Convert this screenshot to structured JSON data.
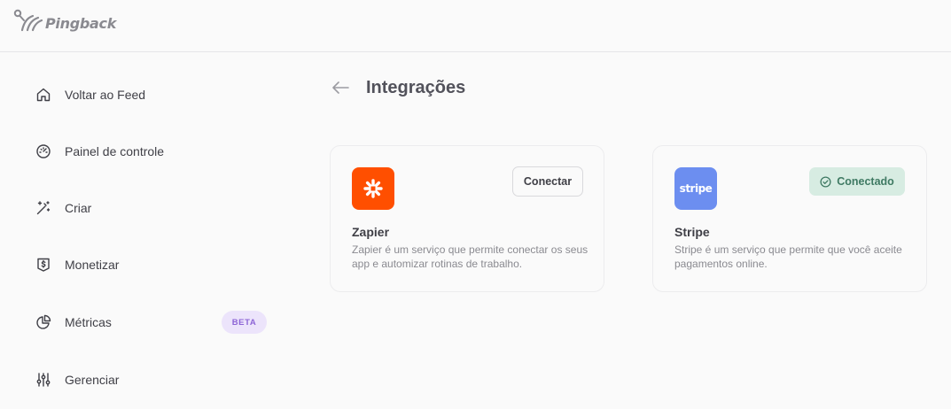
{
  "app": {
    "logo_text": "Pingback"
  },
  "sidebar": {
    "items": [
      {
        "label": "Voltar ao Feed",
        "icon": "home-icon"
      },
      {
        "label": "Painel de controle",
        "icon": "gauge-icon"
      },
      {
        "label": "Criar",
        "icon": "magic-wand-icon"
      },
      {
        "label": "Monetizar",
        "icon": "dollar-badge-icon"
      },
      {
        "label": "Métricas",
        "icon": "pie-chart-icon",
        "badge": "BETA"
      },
      {
        "label": "Gerenciar",
        "icon": "sliders-icon"
      }
    ]
  },
  "main": {
    "title": "Integrações",
    "integrations": [
      {
        "name": "Zapier",
        "description": "Zapier é um serviço que permite conectar os seus app e automizar rotinas de trabalho.",
        "button_label": "Conectar",
        "status": "disconnected",
        "brand_color": "#ff4f00"
      },
      {
        "name": "Stripe",
        "logo_text": "stripe",
        "description": "Stripe é um serviço que permite que você aceite pagamentos online.",
        "button_label": "Conectado",
        "status": "connected",
        "brand_color": "#6c8ef0"
      }
    ]
  },
  "colors": {
    "beta_bg": "#ece4fb",
    "beta_text": "#8d65d6",
    "connected_bg": "#d7ece2",
    "connected_text": "#3f7a63"
  }
}
